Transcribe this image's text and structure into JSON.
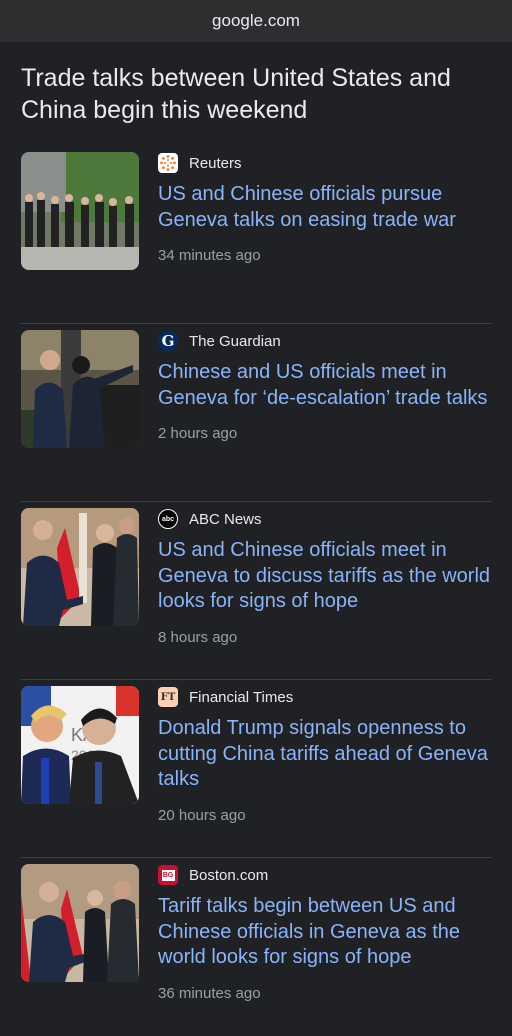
{
  "browser": {
    "url": "google.com"
  },
  "headline": "Trade talks between United States and China begin this weekend",
  "stories": [
    {
      "source": "Reuters",
      "title": "US and Chinese officials pursue Geneva talks on easing trade war",
      "time": "34 minutes ago",
      "favicon": "reuters-icon"
    },
    {
      "source": "The Guardian",
      "title": "Chinese and US officials meet in Geneva for ‘de-escalation’ trade talks",
      "time": "2 hours ago",
      "favicon": "guardian-icon"
    },
    {
      "source": "ABC News",
      "title": "US and Chinese officials meet in Geneva to discuss tariffs as the world looks for signs of hope",
      "time": "8 hours ago",
      "favicon": "abc-news-icon"
    },
    {
      "source": "Financial Times",
      "title": "Donald Trump signals openness to cutting China tariffs ahead of Geneva talks",
      "time": "20 hours ago",
      "favicon": "financial-times-icon"
    },
    {
      "source": "Boston.com",
      "title": "Tariff talks begin between US and Chinese officials in Geneva as the world looks for signs of hope",
      "time": "36 minutes ago",
      "favicon": "boston-com-icon"
    }
  ],
  "favicon_text": {
    "guardian": "G",
    "abc": "abc",
    "ft": "FT",
    "boston": "BG"
  },
  "colors": {
    "link": "#8ab4f8",
    "background": "#202124",
    "muted": "#9aa0a6",
    "reuters": "#f47b20",
    "guardian": "#052962",
    "ft": "#fcd0b1",
    "boston": "#c8102e"
  }
}
